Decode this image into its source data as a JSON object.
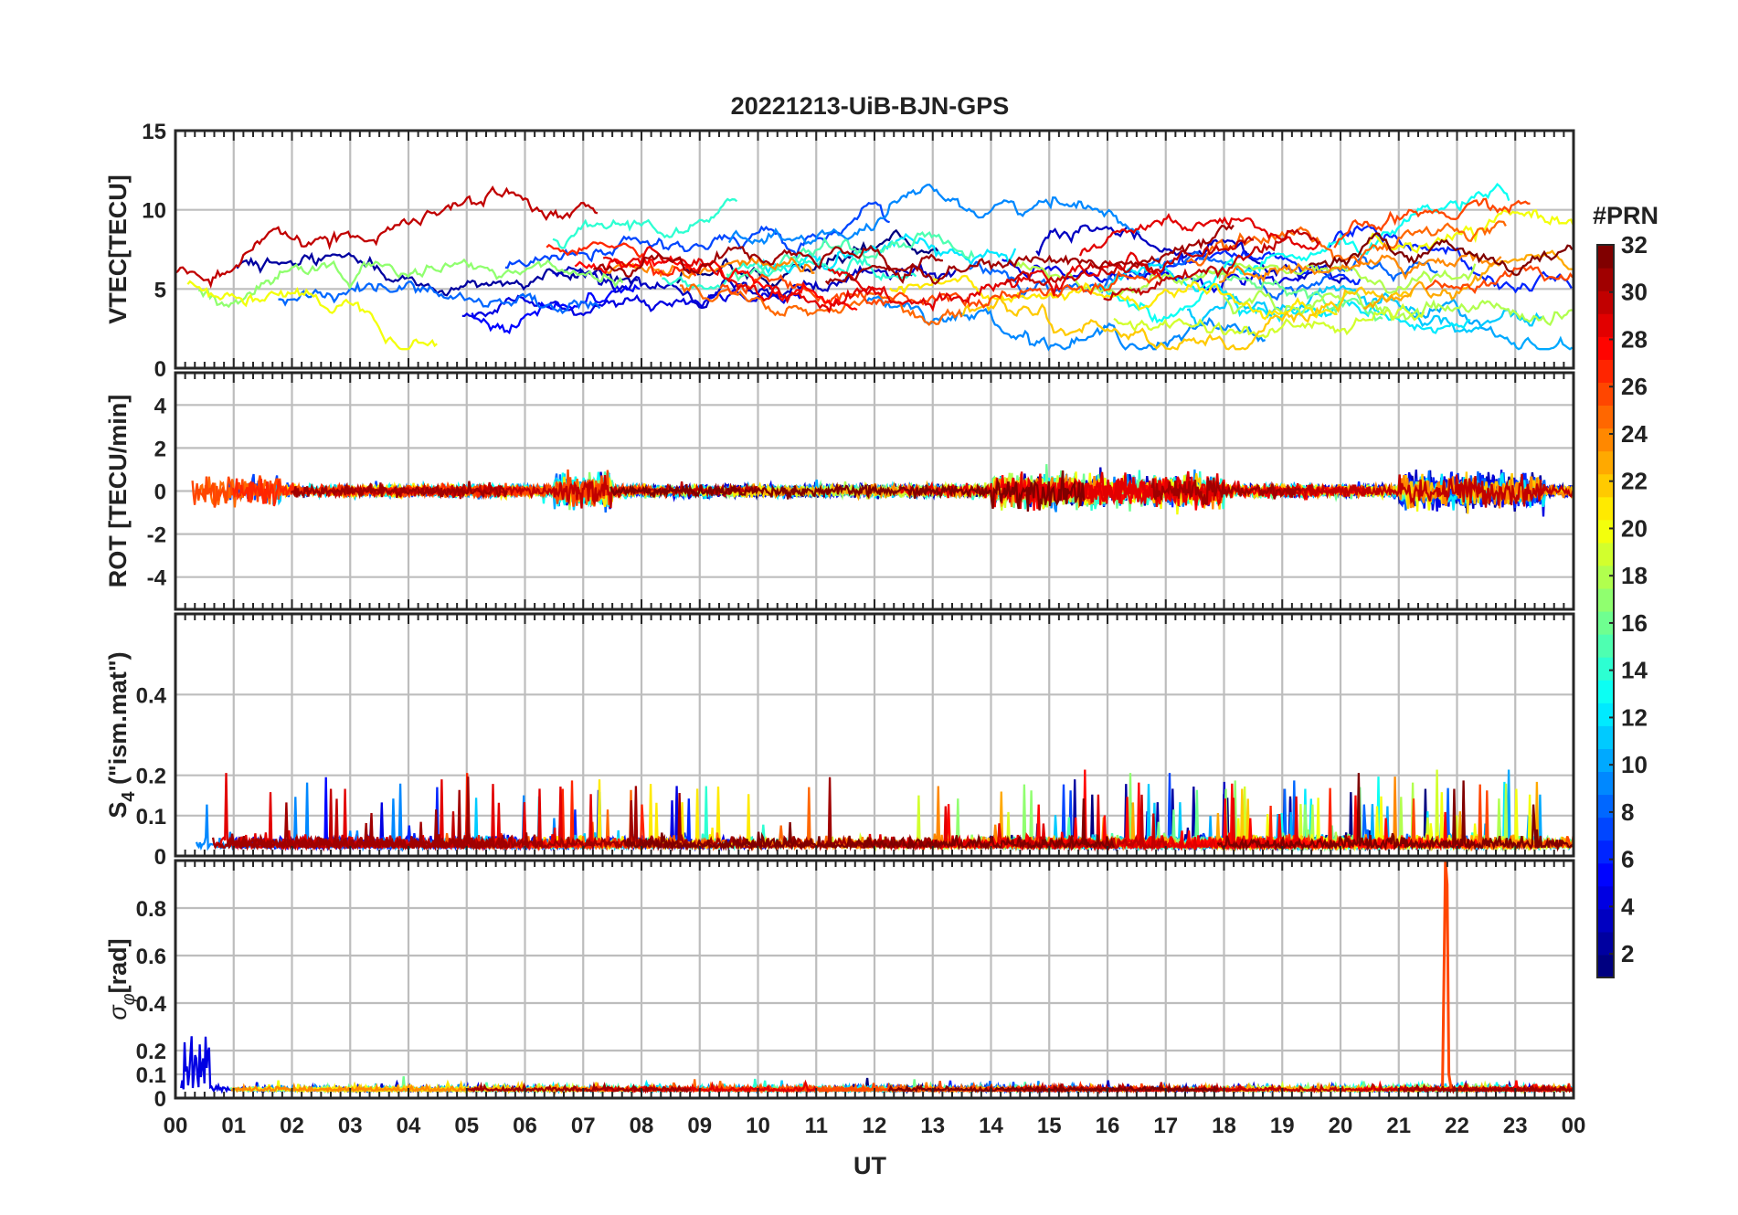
{
  "title": "20221213-UiB-BJN-GPS",
  "xaxis": {
    "label": "UT",
    "ticks": [
      "00",
      "01",
      "02",
      "03",
      "04",
      "05",
      "06",
      "07",
      "08",
      "09",
      "10",
      "11",
      "12",
      "13",
      "14",
      "15",
      "16",
      "17",
      "18",
      "19",
      "20",
      "21",
      "22",
      "23",
      "00"
    ],
    "range": [
      0,
      24
    ]
  },
  "colorbar": {
    "label": "#PRN",
    "range": [
      1,
      32
    ],
    "ticks": [
      2,
      4,
      6,
      8,
      10,
      12,
      14,
      16,
      18,
      20,
      22,
      24,
      26,
      28,
      30,
      32
    ],
    "colormap": "jet",
    "colormap_stops": [
      "#00007f",
      "#0000ff",
      "#007fff",
      "#00ffff",
      "#7fff7f",
      "#ffff00",
      "#ff7f00",
      "#ff0000",
      "#7f0000"
    ]
  },
  "chart_data": [
    {
      "type": "line",
      "panel": "vtec",
      "ylabel": "VTEC[TECU]",
      "ylim": [
        0,
        15
      ],
      "yticks": [
        0,
        5,
        10,
        15
      ],
      "grid": true,
      "series_summary": "32 PRN traces, colored by PRN number"
    },
    {
      "type": "line",
      "panel": "rot",
      "ylabel": "ROT [TECU/min]",
      "ylim": [
        -5.5,
        5.5
      ],
      "yticks": [
        -4,
        -2,
        0,
        2,
        4
      ],
      "grid": true
    },
    {
      "type": "line",
      "panel": "s4",
      "ylabel": "S4 (\"ism.mat\")",
      "ylabel_main": "S",
      "ylabel_sub": "4",
      "ylabel_rest": " (\"ism.mat\")",
      "ylim": [
        0,
        0.6
      ],
      "yticks": [
        0,
        0.1,
        0.2,
        0.4
      ],
      "grid": true
    },
    {
      "type": "line",
      "panel": "sigma_phi",
      "ylabel": "σφ[rad]",
      "ylabel_main": "σ",
      "ylabel_sub": "φ",
      "ylabel_rest": "[rad]",
      "ylim": [
        0,
        1
      ],
      "yticks": [
        0,
        0.1,
        0.2,
        0.4,
        0.6,
        0.8
      ],
      "grid": true
    }
  ]
}
